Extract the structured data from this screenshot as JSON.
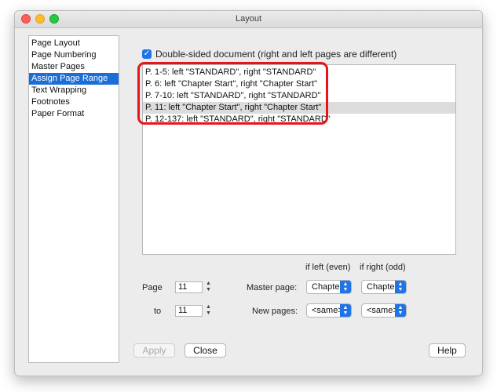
{
  "window": {
    "title": "Layout"
  },
  "sidebar": {
    "items": [
      {
        "label": "Page Layout"
      },
      {
        "label": "Page Numbering"
      },
      {
        "label": "Master Pages"
      },
      {
        "label": "Assign Page Range",
        "selected": true
      },
      {
        "label": "Text Wrapping"
      },
      {
        "label": "Footnotes"
      },
      {
        "label": "Paper Format"
      }
    ]
  },
  "double_sided": {
    "checked": true,
    "label": "Double-sided document (right and left pages are different)"
  },
  "ranges": [
    "P. 1-5: left \"STANDARD\", right \"STANDARD\"",
    "P. 6: left \"Chapter Start\", right \"Chapter Start\"",
    "P. 7-10: left \"STANDARD\", right \"STANDARD\"",
    "P. 11: left \"Chapter Start\", right \"Chapter Start\"",
    "P. 12-137: left \"STANDARD\", right \"STANDARD\""
  ],
  "selected_range_index": 3,
  "columns": {
    "left": "if left (even)",
    "right": "if right (odd)"
  },
  "form": {
    "page_label": "Page",
    "page_value": "11",
    "to_label": "to",
    "to_value": "11",
    "master_page_label": "Master page:",
    "master_left": "Chapter Start",
    "master_right": "Chapter Start",
    "new_pages_label": "New pages:",
    "new_left": "<same>",
    "new_right": "<same>"
  },
  "buttons": {
    "apply": "Apply",
    "close": "Close",
    "help": "Help"
  },
  "colors": {
    "accent": "#1f74e6",
    "highlight_ring": "#e8141b",
    "sidebar_selected": "#1b6ed8"
  }
}
